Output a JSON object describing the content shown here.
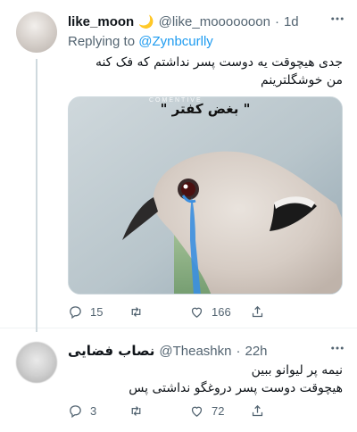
{
  "tweets": [
    {
      "name": "like_moon",
      "handle": "@like_mooooooon",
      "separator": "·",
      "time": "1d",
      "replying_prefix": "Replying to",
      "replying_to": "@Zynbcurlly",
      "text_lines": [
        "جدی هیچوقت یه دوست پسر نداشتم که فک کنه",
        "من خوشگلترینم"
      ],
      "media": {
        "watermark": "COMENTIVE",
        "caption": "\"  بغض کفتر  \"",
        "description_icon": "crying-dove-image"
      },
      "actions": {
        "replies": "15",
        "retweets": "",
        "likes": "166"
      }
    },
    {
      "name": "نصاب فضایی",
      "handle": "@Theashkn",
      "separator": "·",
      "time": "22h",
      "text_lines": [
        "نیمه پر لیوانو ببین",
        "هیچوقت دوست پسر دروغگو نداشتی پس"
      ],
      "actions": {
        "replies": "3",
        "retweets": "",
        "likes": "72"
      }
    }
  ],
  "icons": {
    "more": "more-dots-icon",
    "reply": "reply-bubble-icon",
    "retweet": "retweet-icon",
    "like": "heart-icon",
    "share": "share-icon",
    "moon": "crescent-moon-emoji"
  },
  "colors": {
    "text": "#0f1419",
    "secondary": "#536471",
    "accent": "#1d9bf0",
    "divider": "#eff3f4"
  }
}
